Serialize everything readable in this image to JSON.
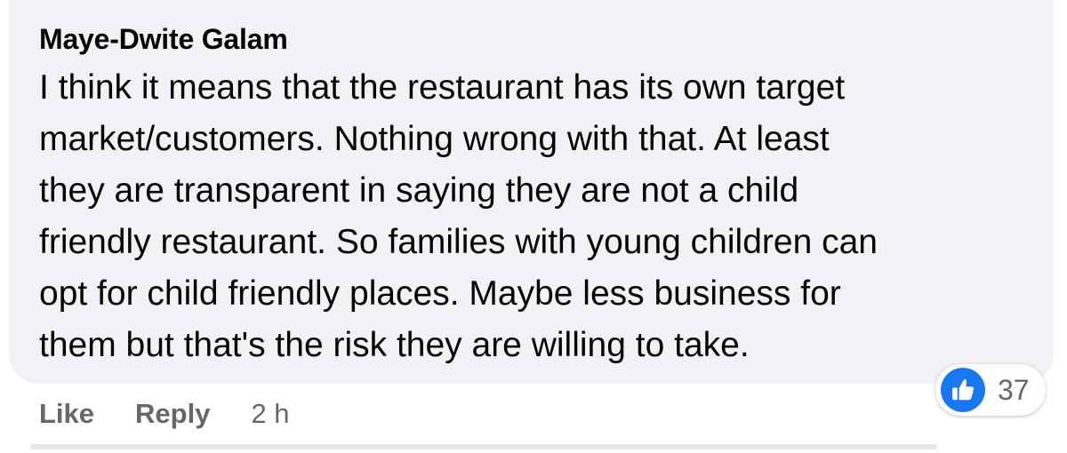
{
  "comment": {
    "author": "Maye-Dwite Galam",
    "text": "I think it means that the restaurant has its own target\nmarket/customers. Nothing wrong with that. At least\nthey are transparent in saying they are not a child\nfriendly restaurant. So families with young children can\nopt for child friendly places. Maybe less business for\nthem but that's the risk they are willing to take.",
    "actions": {
      "like_label": "Like",
      "reply_label": "Reply",
      "timestamp": "2 h"
    },
    "reactions": {
      "icon": "thumbs-up-icon",
      "count": "37"
    }
  },
  "colors": {
    "bubble_background": "#f0f2f5",
    "primary_text": "#050505",
    "secondary_text": "#65676b",
    "like_blue": "#1877f2"
  }
}
